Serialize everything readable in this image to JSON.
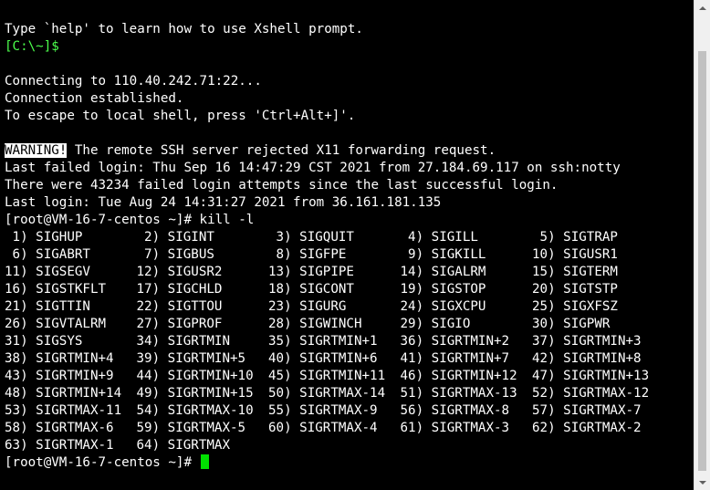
{
  "terminal": {
    "help_text": "Type `help' to learn how to use Xshell prompt.",
    "local_prompt": "[C:\\~]$",
    "connecting": "Connecting to 110.40.242.71:22...",
    "established": "Connection established.",
    "escape_hint": "To escape to local shell, press 'Ctrl+Alt+]'.",
    "warning_label": "WARNING!",
    "warning_text": " The remote SSH server rejected X11 forwarding request.",
    "last_failed": "Last failed login: Thu Sep 16 14:47:29 CST 2021 from 27.184.69.117 on ssh:notty",
    "failed_attempts": "There were 43234 failed login attempts since the last successful login.",
    "last_login": "Last login: Tue Aug 24 14:31:27 2021 from 36.161.181.135",
    "command_line": "[root@VM-16-7-centos ~]# kill -l",
    "final_prompt": "[root@VM-16-7-centos ~]# ",
    "signals": [
      " 1) SIGHUP",
      " 2) SIGINT",
      " 3) SIGQUIT",
      " 4) SIGILL",
      " 5) SIGTRAP",
      " 6) SIGABRT",
      " 7) SIGBUS",
      " 8) SIGFPE",
      " 9) SIGKILL",
      "10) SIGUSR1",
      "11) SIGSEGV",
      "12) SIGUSR2",
      "13) SIGPIPE",
      "14) SIGALRM",
      "15) SIGTERM",
      "16) SIGSTKFLT",
      "17) SIGCHLD",
      "18) SIGCONT",
      "19) SIGSTOP",
      "20) SIGTSTP",
      "21) SIGTTIN",
      "22) SIGTTOU",
      "23) SIGURG",
      "24) SIGXCPU",
      "25) SIGXFSZ",
      "26) SIGVTALRM",
      "27) SIGPROF",
      "28) SIGWINCH",
      "29) SIGIO",
      "30) SIGPWR",
      "31) SIGSYS",
      "34) SIGRTMIN",
      "35) SIGRTMIN+1",
      "36) SIGRTMIN+2",
      "37) SIGRTMIN+3",
      "38) SIGRTMIN+4",
      "39) SIGRTMIN+5",
      "40) SIGRTMIN+6",
      "41) SIGRTMIN+7",
      "42) SIGRTMIN+8",
      "43) SIGRTMIN+9",
      "44) SIGRTMIN+10",
      "45) SIGRTMIN+11",
      "46) SIGRTMIN+12",
      "47) SIGRTMIN+13",
      "48) SIGRTMIN+14",
      "49) SIGRTMIN+15",
      "50) SIGRTMAX-14",
      "51) SIGRTMAX-13",
      "52) SIGRTMAX-12",
      "53) SIGRTMAX-11",
      "54) SIGRTMAX-10",
      "55) SIGRTMAX-9",
      "56) SIGRTMAX-8",
      "57) SIGRTMAX-7",
      "58) SIGRTMAX-6",
      "59) SIGRTMAX-5",
      "60) SIGRTMAX-4",
      "61) SIGRTMAX-3",
      "62) SIGRTMAX-2",
      "63) SIGRTMAX-1",
      "64) SIGRTMAX"
    ]
  },
  "colors": {
    "background": "#000000",
    "foreground": "#ffffff",
    "local_prompt": "#4cff4c",
    "cursor": "#00e000"
  },
  "scrollbar": {
    "up_icon": "triangle-up-icon",
    "down_icon": "triangle-down-icon"
  }
}
